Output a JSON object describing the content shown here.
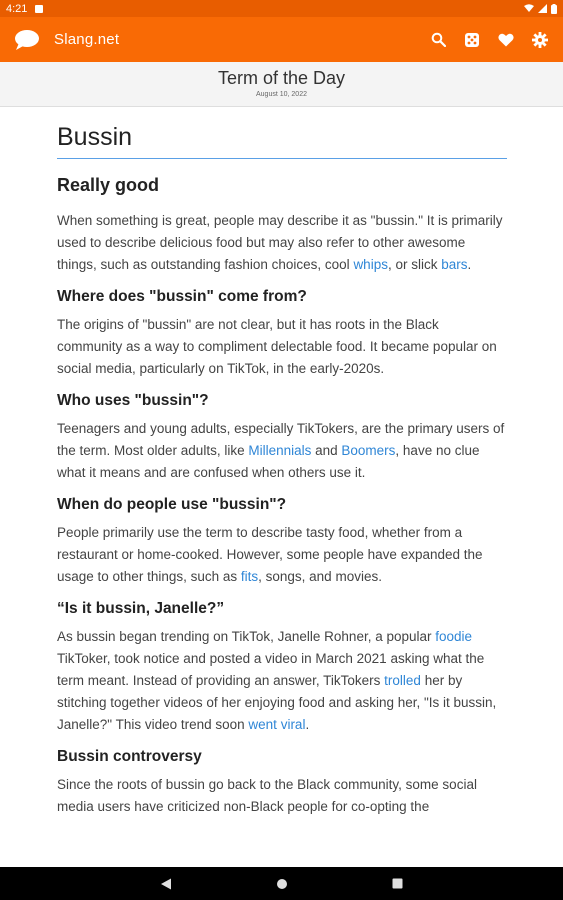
{
  "status_bar": {
    "time": "4:21"
  },
  "app_bar": {
    "title": "Slang.net"
  },
  "sub_header": {
    "title": "Term of the Day",
    "date": "August 10, 2022"
  },
  "article": {
    "word": "Bussin",
    "definition": "Really good",
    "p1": {
      "t1": "When something is great, people may describe it as \"bussin.\" It is primarily used to describe delicious food but may also refer to other awesome things, such as outstanding fashion choices, cool ",
      "l1": "whips",
      "t2": ", or slick ",
      "l2": "bars",
      "t3": "."
    },
    "h_origin": "Where does \"bussin\" come from?",
    "p2": "The origins of \"bussin\" are not clear, but it has roots in the Black community as a way to compliment delectable food. It became popular on social media, particularly on TikTok, in the early-2020s.",
    "h_users": "Who uses \"bussin\"?",
    "p3": {
      "t1": "Teenagers and young adults, especially TikTokers, are the primary users of the term. Most older adults, like ",
      "l1": "Millennials",
      "t2": " and ",
      "l2": "Boomers",
      "t3": ", have no clue what it means and are confused when others use it."
    },
    "h_when": "When do people use \"bussin\"?",
    "p4": {
      "t1": "People primarily use the term to describe tasty food, whether from a restaurant or home-cooked. However, some people have expanded the usage to other things, such as ",
      "l1": "fits",
      "t2": ", songs, and movies."
    },
    "h_janelle": "“Is it bussin, Janelle?”",
    "p5": {
      "t1": "As bussin began trending on TikTok, Janelle Rohner, a popular ",
      "l1": "foodie",
      "t2": " TikToker, took notice and posted a video in March 2021 asking what the term meant. Instead of providing an answer, TikTokers ",
      "l2": "trolled",
      "t3": " her by stitching together videos of her enjoying food and asking her, \"Is it bussin, Janelle?\" This video trend soon ",
      "l3": "went viral",
      "t4": "."
    },
    "h_controversy": "Bussin controversy",
    "p6": "Since the roots of bussin go back to the Black community, some social media users have criticized non-Black people for co-opting the"
  },
  "icons": {
    "logo": "speech-bubble-icon",
    "search": "search-icon",
    "random": "dice-icon",
    "favorites": "heart-icon",
    "settings": "gear-icon",
    "back": "back-triangle-icon",
    "home": "home-circle-icon",
    "recents": "recents-square-icon"
  },
  "colors": {
    "app_bar": "#f96a05",
    "status_bar": "#e85d00",
    "link": "#2f86d6",
    "accent_rule": "#5aa0e6"
  }
}
